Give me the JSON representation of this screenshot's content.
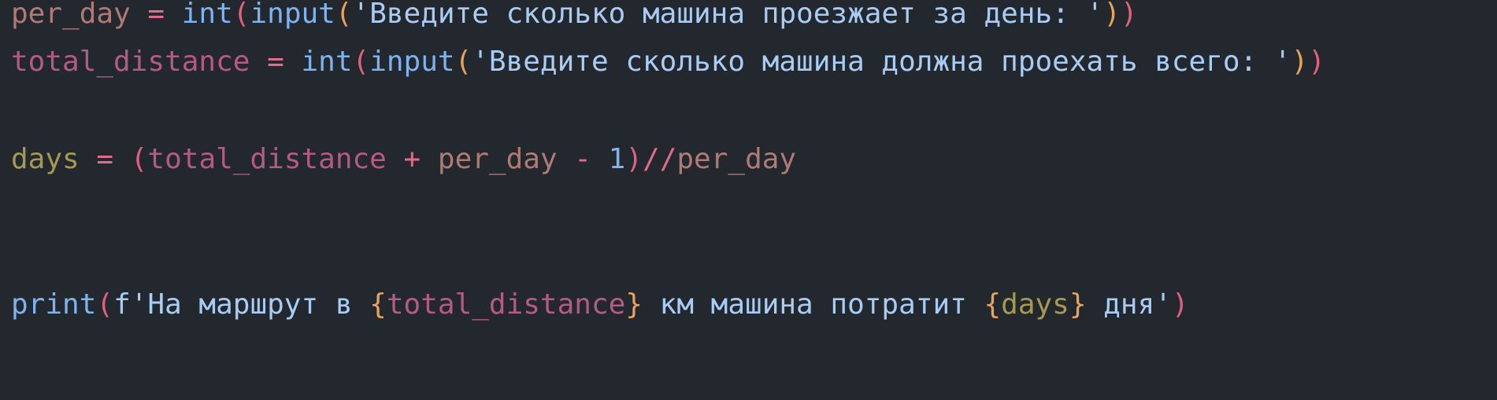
{
  "code": {
    "line1": {
      "var": "per_day",
      "eq": " = ",
      "int_fn": "int",
      "p_open1": "(",
      "input_fn": "input",
      "p_open2": "(",
      "string": "'Введите сколько машина проезжает за день: '",
      "p_close2": ")",
      "p_close1": ")"
    },
    "line2": {
      "var": "total_distance",
      "eq": " = ",
      "int_fn": "int",
      "p_open1": "(",
      "input_fn": "input",
      "p_open2": "(",
      "string": "'Введите сколько машина должна проехать всего: '",
      "p_close2": ")",
      "p_close1": ")"
    },
    "line3": {
      "var": "days",
      "eq": " = ",
      "p_open": "(",
      "op1_var": "total_distance",
      "plus": " + ",
      "op2_var": "per_day",
      "minus": " - ",
      "num": "1",
      "p_close": ")",
      "floordiv": "//",
      "op3_var": "per_day"
    },
    "line4": {
      "print_fn": "print",
      "p_open": "(",
      "fstring_start": "f'На маршрут в ",
      "brace1_open": "{",
      "interp1": "total_distance",
      "brace1_close": "}",
      "mid": " км машина потратит ",
      "brace2_open": "{",
      "interp2": "days",
      "brace2_close": "}",
      "fstring_end": " дня'",
      "p_close": ")"
    }
  },
  "theme": {
    "background": "#23272e",
    "variable_per_day": "#b07a74",
    "variable_total_distance": "#b55a83",
    "variable_days": "#a69a52",
    "function": "#7fb3f0",
    "string": "#a9ccf4",
    "operator": "#e06c8a",
    "bracket_outer": "#e0607e",
    "bracket_inner": "#e8a25a"
  }
}
